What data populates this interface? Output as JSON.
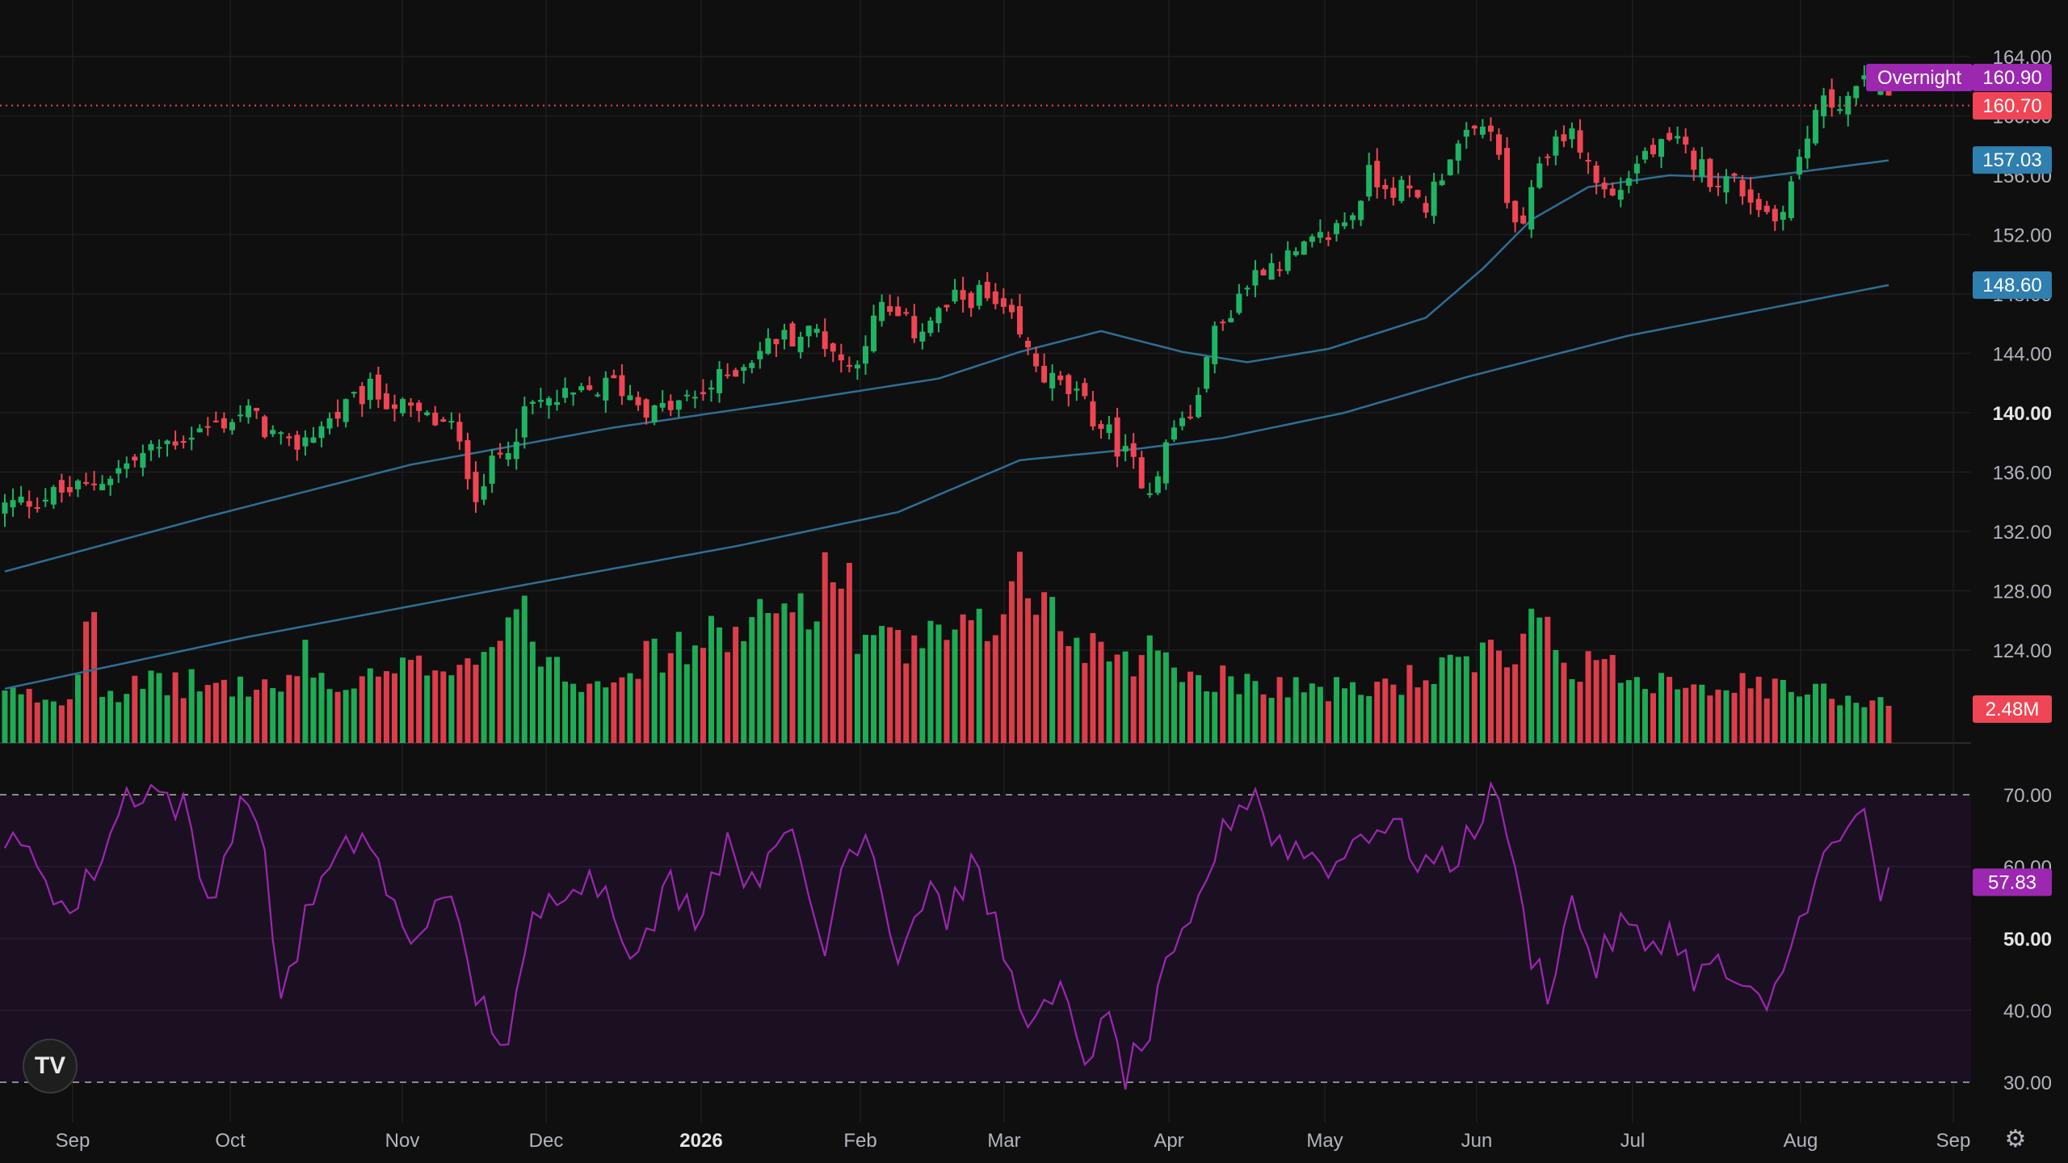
{
  "chart_data": {
    "type": "candlestick",
    "price_axis": {
      "range": [
        130,
        166
      ],
      "ticks": [
        "164.00",
        "160.00",
        "156.00",
        "152.00",
        "148.00",
        "144.00",
        "140.00",
        "136.00",
        "132.00",
        "128.00",
        "124.00"
      ],
      "bold_tick": "140.00"
    },
    "rsi_axis": {
      "range": [
        28,
        74
      ],
      "ticks": [
        "70.00",
        "60.00",
        "50.00",
        "40.00",
        "30.00"
      ],
      "bold_tick": "50.00",
      "upper_band": 70,
      "lower_band": 30
    },
    "x_axis": {
      "labels": [
        "Sep",
        "Oct",
        "Nov",
        "Dec",
        "2026",
        "Feb",
        "Mar",
        "Apr",
        "May",
        "Jun",
        "Jul",
        "Aug",
        "Sep"
      ],
      "bold_label": "2026"
    },
    "last_price": "160.70",
    "overnight": {
      "label": "Overnight",
      "price": "160.90"
    },
    "ma_fast": {
      "last": "157.03",
      "anchors": [
        [
          0,
          129.3
        ],
        [
          25,
          133.0
        ],
        [
          50,
          136.5
        ],
        [
          75,
          139.0
        ],
        [
          95,
          140.6
        ],
        [
          115,
          142.3
        ],
        [
          125,
          144.1
        ],
        [
          135,
          145.5
        ],
        [
          145,
          144.1
        ],
        [
          153,
          143.4
        ],
        [
          163,
          144.3
        ],
        [
          175,
          146.4
        ],
        [
          182,
          149.7
        ],
        [
          188,
          153.0
        ],
        [
          195,
          155.2
        ],
        [
          205,
          156.0
        ],
        [
          215,
          155.8
        ],
        [
          232,
          157.0
        ]
      ]
    },
    "ma_slow": {
      "last": "148.60",
      "anchors": [
        [
          0,
          121.4
        ],
        [
          30,
          124.9
        ],
        [
          60,
          128.0
        ],
        [
          90,
          131.0
        ],
        [
          110,
          133.3
        ],
        [
          125,
          136.8
        ],
        [
          140,
          137.6
        ],
        [
          150,
          138.3
        ],
        [
          165,
          140.0
        ],
        [
          180,
          142.4
        ],
        [
          200,
          145.2
        ],
        [
          232,
          148.6
        ]
      ]
    },
    "volume": {
      "last": "2.48M",
      "max_value": 10.8
    },
    "rsi": {
      "last": "57.83"
    },
    "candle_count": 233,
    "close_anchors": [
      [
        0,
        133.7
      ],
      [
        10,
        135.0
      ],
      [
        20,
        138.0
      ],
      [
        30,
        140.0
      ],
      [
        35,
        137.5
      ],
      [
        40,
        139.5
      ],
      [
        45,
        141.5
      ],
      [
        50,
        140.0
      ],
      [
        55,
        139.0
      ],
      [
        58,
        134.7
      ],
      [
        62,
        138.0
      ],
      [
        65,
        140.5
      ],
      [
        70,
        141.0
      ],
      [
        75,
        142.0
      ],
      [
        80,
        140.0
      ],
      [
        85,
        141.0
      ],
      [
        90,
        143.0
      ],
      [
        95,
        145.0
      ],
      [
        100,
        145.5
      ],
      [
        104,
        143.0
      ],
      [
        108,
        147.0
      ],
      [
        112,
        145.5
      ],
      [
        117,
        147.5
      ],
      [
        120,
        148.0
      ],
      [
        124,
        146.0
      ],
      [
        126,
        144.0
      ],
      [
        128,
        142.5
      ],
      [
        132,
        141.0
      ],
      [
        136,
        138.5
      ],
      [
        141,
        135.0
      ],
      [
        144,
        139.0
      ],
      [
        147,
        140.5
      ],
      [
        148,
        144.5
      ],
      [
        150,
        146.0
      ],
      [
        152,
        148.0
      ],
      [
        155,
        150.0
      ],
      [
        159,
        150.5
      ],
      [
        163,
        152.0
      ],
      [
        166,
        153.5
      ],
      [
        168,
        156.0
      ],
      [
        172,
        155.0
      ],
      [
        175,
        154.0
      ],
      [
        178,
        157.5
      ],
      [
        183,
        159.5
      ],
      [
        185,
        154.0
      ],
      [
        187,
        152.0
      ],
      [
        189,
        157.0
      ],
      [
        192,
        159.0
      ],
      [
        194,
        158.0
      ],
      [
        196,
        155.5
      ],
      [
        198,
        154.5
      ],
      [
        202,
        157.5
      ],
      [
        206,
        158.0
      ],
      [
        210,
        156.0
      ],
      [
        213,
        155.5
      ],
      [
        216,
        154.0
      ],
      [
        218,
        153.0
      ],
      [
        220,
        155.5
      ],
      [
        222,
        158.5
      ],
      [
        223,
        160.5
      ],
      [
        228,
        161.5
      ],
      [
        230,
        162.5
      ],
      [
        232,
        160.7
      ]
    ],
    "volume_anchors": [
      [
        0,
        2.8
      ],
      [
        8,
        2.5
      ],
      [
        11,
        10.0
      ],
      [
        12,
        3.0
      ],
      [
        20,
        3.5
      ],
      [
        35,
        3.2
      ],
      [
        37,
        5.5
      ],
      [
        40,
        3.0
      ],
      [
        60,
        5.5
      ],
      [
        62,
        8.0
      ],
      [
        70,
        3.6
      ],
      [
        87,
        6.0
      ],
      [
        88,
        7.5
      ],
      [
        90,
        6.0
      ],
      [
        104,
        10.2
      ],
      [
        105,
        6.0
      ],
      [
        110,
        5.5
      ],
      [
        122,
        6.5
      ],
      [
        124,
        11.5
      ],
      [
        126,
        8.0
      ],
      [
        128,
        8.0
      ],
      [
        132,
        6.0
      ],
      [
        140,
        5.0
      ],
      [
        143,
        6.0
      ],
      [
        145,
        4.0
      ],
      [
        166,
        3.0
      ],
      [
        180,
        4.5
      ],
      [
        187,
        5.5
      ],
      [
        189,
        9.5
      ],
      [
        191,
        5.0
      ],
      [
        200,
        4.0
      ],
      [
        232,
        2.48
      ]
    ],
    "rsi_anchors": [
      [
        0,
        63
      ],
      [
        4,
        61
      ],
      [
        8,
        53
      ],
      [
        12,
        62
      ],
      [
        15,
        70
      ],
      [
        18,
        71
      ],
      [
        22,
        68
      ],
      [
        25,
        55
      ],
      [
        30,
        71
      ],
      [
        32,
        60
      ],
      [
        34,
        42
      ],
      [
        38,
        56
      ],
      [
        44,
        65
      ],
      [
        46,
        60
      ],
      [
        50,
        48
      ],
      [
        54,
        58
      ],
      [
        58,
        42
      ],
      [
        62,
        35
      ],
      [
        65,
        52
      ],
      [
        70,
        59
      ],
      [
        74,
        57
      ],
      [
        76,
        52
      ],
      [
        78,
        47
      ],
      [
        82,
        58
      ],
      [
        85,
        53
      ],
      [
        89,
        64
      ],
      [
        92,
        57
      ],
      [
        96,
        67
      ],
      [
        99,
        55
      ],
      [
        101,
        48
      ],
      [
        103,
        60
      ],
      [
        106,
        66
      ],
      [
        110,
        48
      ],
      [
        114,
        58
      ],
      [
        116,
        53
      ],
      [
        119,
        60
      ],
      [
        122,
        52
      ],
      [
        124,
        44
      ],
      [
        127,
        38
      ],
      [
        130,
        42
      ],
      [
        133,
        34
      ],
      [
        136,
        38
      ],
      [
        138,
        31
      ],
      [
        141,
        37
      ],
      [
        143,
        45
      ],
      [
        146,
        51
      ],
      [
        148,
        59
      ],
      [
        151,
        67
      ],
      [
        154,
        71
      ],
      [
        156,
        64
      ],
      [
        160,
        62
      ],
      [
        164,
        60
      ],
      [
        167,
        65
      ],
      [
        171,
        66
      ],
      [
        174,
        61
      ],
      [
        178,
        60
      ],
      [
        181,
        66
      ],
      [
        184,
        71
      ],
      [
        186,
        58
      ],
      [
        188,
        48
      ],
      [
        190,
        43
      ],
      [
        193,
        55
      ],
      [
        196,
        46
      ],
      [
        199,
        52
      ],
      [
        202,
        49
      ],
      [
        205,
        51
      ],
      [
        208,
        45
      ],
      [
        211,
        46
      ],
      [
        214,
        43
      ],
      [
        217,
        39
      ],
      [
        219,
        46
      ],
      [
        221,
        52
      ],
      [
        223,
        60
      ],
      [
        226,
        63
      ],
      [
        229,
        68
      ],
      [
        231,
        56
      ],
      [
        232,
        57.83
      ]
    ]
  },
  "icons": {
    "logo": "tradingview-logo",
    "settings": "settings-icon"
  },
  "logo_text": "TV",
  "colors": {
    "up": "#26a69a",
    "up_candle": "#1fb364",
    "down": "#f04554",
    "ma": "#2f6e96",
    "rsi_line": "#9c27b0",
    "rsi_fill": "#1b1022",
    "overnight": "#9c27b0",
    "last": "#f04554",
    "ma_badge": "#2f7fb0"
  }
}
